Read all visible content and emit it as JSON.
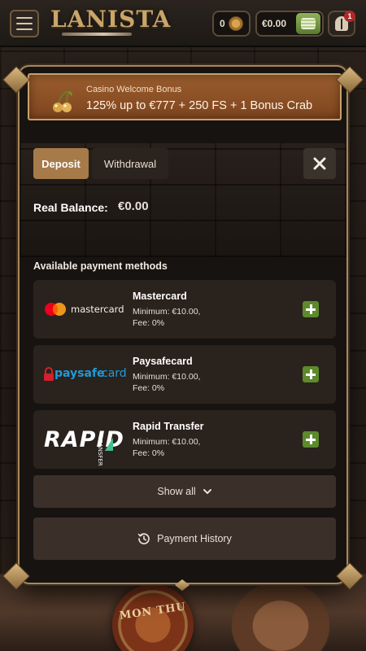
{
  "header": {
    "logo_text": "LANISTA",
    "coins_count": "0",
    "balance": "€0.00",
    "notification_count": "1"
  },
  "bonus": {
    "kicker": "Casino Welcome Bonus",
    "title": "125% up to €777 + 250 FS + 1 Bonus Crab"
  },
  "tabs": [
    {
      "label": "Deposit",
      "active": true
    },
    {
      "label": "Withdrawal",
      "active": false
    }
  ],
  "balance": {
    "label": "Real Balance:",
    "value": "€0.00"
  },
  "methods_heading": "Available payment methods",
  "methods": [
    {
      "name": "Mastercard",
      "logo_text": "mastercard",
      "minimum": "Minimum: €10.00,",
      "fee": "Fee: 0%"
    },
    {
      "name": "Paysafecard",
      "logo_text_a": "paysafe",
      "logo_text_b": "card",
      "minimum": "Minimum: €10.00,",
      "fee": "Fee: 0%"
    },
    {
      "name": "Rapid Transfer",
      "logo_text_a": "RAPID",
      "logo_text_b": "TRANSFER",
      "minimum": "Minimum: €10.00,",
      "fee": "Fee: 0%"
    }
  ],
  "show_all_label": "Show all",
  "payment_history_label": "Payment History",
  "hero_text": "MON THU",
  "colors": {
    "accent": "#a67a49",
    "add_green": "#5d8a2c",
    "banner": "#8a4e25",
    "modal_bg": "#171311"
  },
  "icons": [
    "menu-icon",
    "coin-icon",
    "cash-stack-icon",
    "helmet-icon",
    "cherry-icon",
    "close-icon",
    "plus-icon",
    "chevron-down-icon",
    "history-icon"
  ]
}
